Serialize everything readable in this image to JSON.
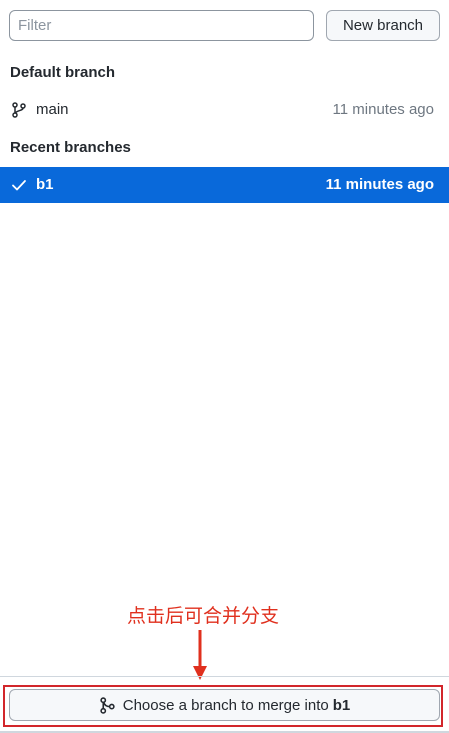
{
  "filter": {
    "placeholder": "Filter",
    "value": ""
  },
  "new_branch_label": "New branch",
  "sections": {
    "default_label": "Default branch",
    "recent_label": "Recent branches"
  },
  "branches": {
    "default": {
      "name": "main",
      "time": "11 minutes ago",
      "icon": "git-branch-icon"
    },
    "recent": [
      {
        "name": "b1",
        "time": "11 minutes ago",
        "icon": "check-icon",
        "selected": true
      }
    ]
  },
  "annotation": {
    "text": "点击后可合并分支",
    "color": "#e0301e"
  },
  "merge_button": {
    "prefix": "Choose a branch to merge into",
    "branch": "b1",
    "icon": "git-merge-icon"
  },
  "colors": {
    "selected_row": "#0969da",
    "annotation_red": "#d2262b"
  }
}
